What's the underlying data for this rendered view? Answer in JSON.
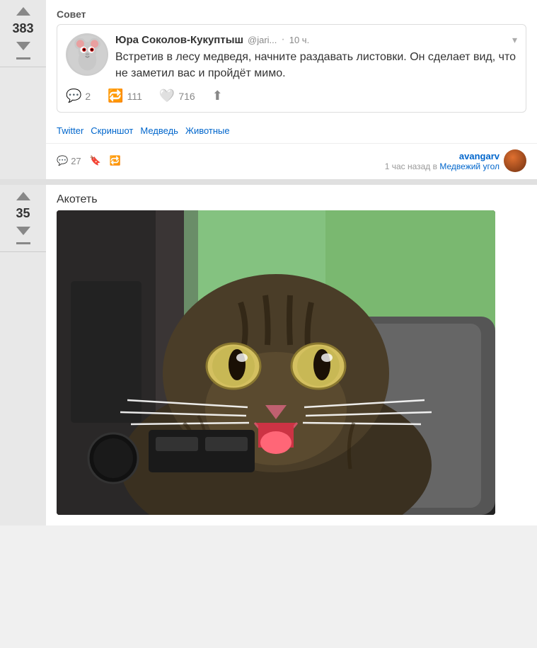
{
  "post1": {
    "title": "Совет",
    "vote_count": "383",
    "author_name": "Юра Соколов-Кукуптыш",
    "author_handle": "@jari...",
    "time_ago": "10 ч.",
    "tweet_text": "Встретив в лесу медведя, начните раздавать листовки. Он сделает вид, что не заметил вас и пройдёт мимо.",
    "action_comments": "2",
    "action_retweets": "111",
    "action_likes": "716",
    "tags": [
      "Twitter",
      "Скриншот",
      "Медведь",
      "Животные"
    ],
    "meta_comments": "27",
    "meta_author": "avangarv",
    "meta_time": "1 час назад",
    "meta_community": "Медвежий угол",
    "dropdown_label": "▾"
  },
  "post2": {
    "title": "Акотеть",
    "vote_count": "35"
  },
  "icons": {
    "comment": "💬",
    "retweet": "🔁",
    "like": "🤍",
    "share": "⬆",
    "comment_meta": "💬",
    "bookmark": "🔖",
    "retweet_meta": "🔁"
  }
}
